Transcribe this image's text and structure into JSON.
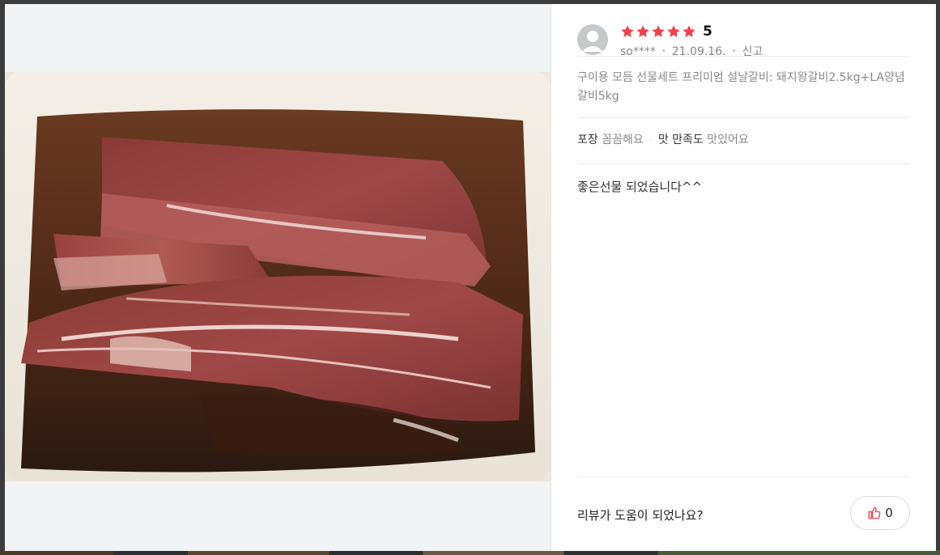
{
  "photo": {
    "alt": "",
    "icon": "marinated-galbi-photo"
  },
  "review": {
    "rating_stars": 5,
    "rating_value": "5",
    "user": "so****",
    "date": "21.09.16.",
    "report_label": "신고",
    "product_option": "구이용 모듬 선물세트 프리미엄 설날갈비: 돼지왕갈비2.5kg+LA양념갈비5kg",
    "evaluations": [
      {
        "key": "포장",
        "value": "꼼꼼해요"
      },
      {
        "key": "맛 만족도",
        "value": "맛있어요"
      }
    ],
    "body": "좋은선물 되었습니다^^"
  },
  "footer": {
    "question": "리뷰가 도움이 되었나요?",
    "like_count": "0"
  },
  "colors": {
    "star": "#f0414a",
    "like_icon": "#f0414a",
    "avatar": "#c6c9cc"
  }
}
